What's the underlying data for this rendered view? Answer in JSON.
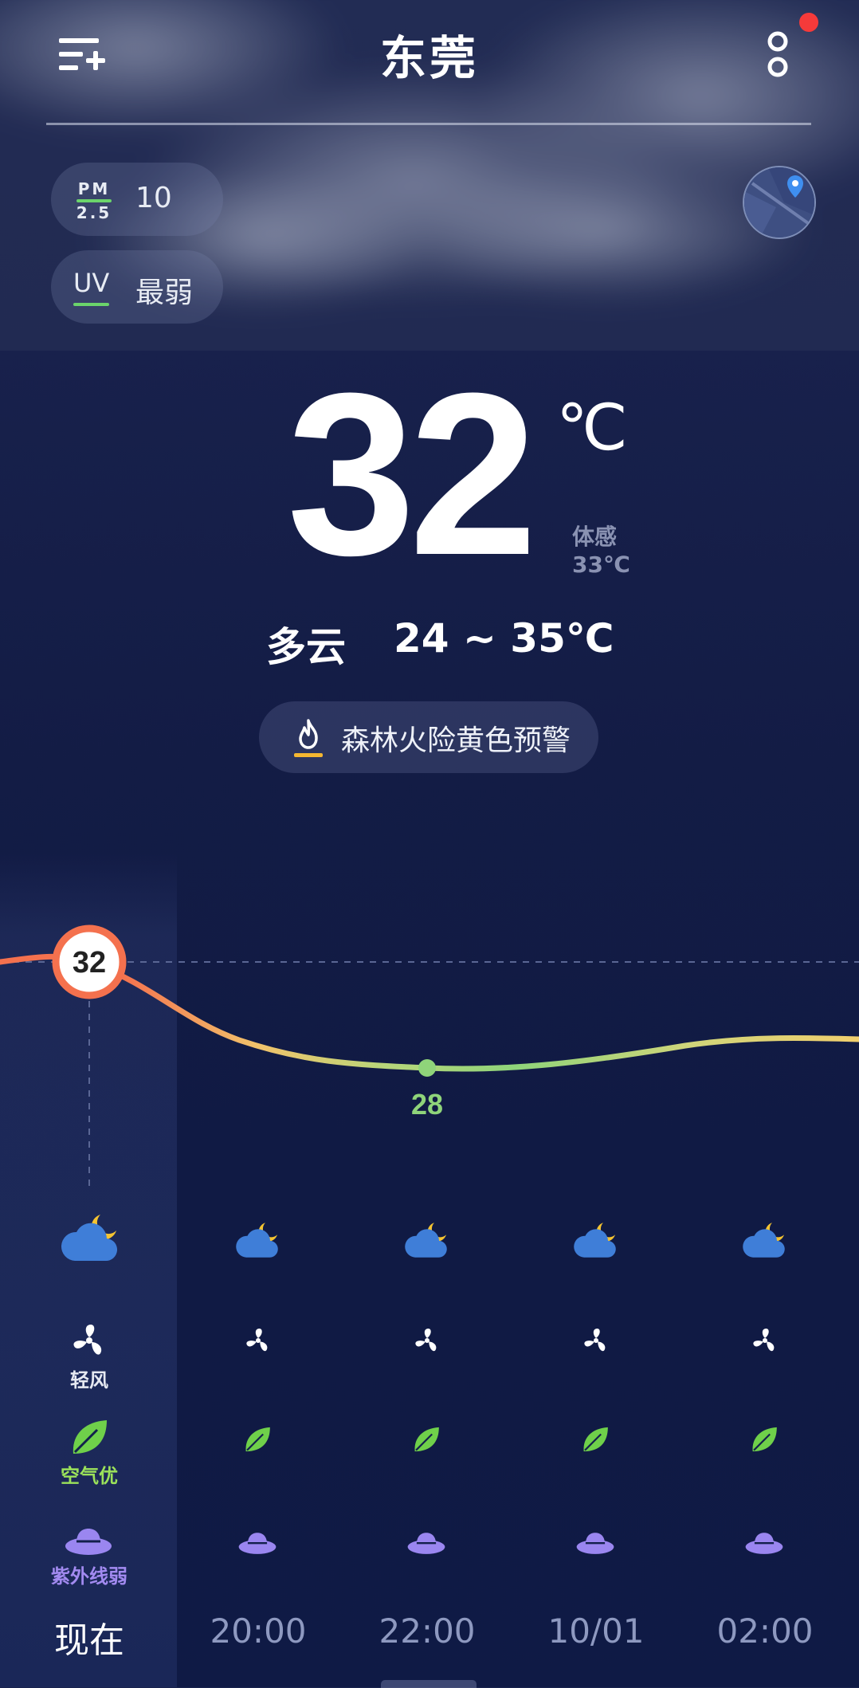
{
  "header": {
    "city": "东莞",
    "menu_icon": "menu-add-icon",
    "more_icon": "more-icon"
  },
  "air": {
    "pm_icon_top": "PM",
    "pm_icon_bottom": "2.5",
    "pm_value": "10",
    "uv_icon_text": "UV",
    "uv_value": "最弱"
  },
  "current": {
    "temperature": "32",
    "unit": "℃",
    "feels_like_label": "体感",
    "feels_like_value": "33℃",
    "condition": "多云",
    "range": "24 ~ 35℃"
  },
  "alert": {
    "text": "森林火险黄色预警",
    "color": "#f5b731"
  },
  "hourly": {
    "chart_data": {
      "type": "line",
      "title": "",
      "points": [
        {
          "label": "现在",
          "value": 32
        },
        {
          "label": "22:00",
          "value": 28
        }
      ],
      "max_label": "32",
      "min_label": "28"
    },
    "times": [
      "现在",
      "20:00",
      "22:00",
      "10/01",
      "02:00"
    ],
    "weather_icon": "cloudy-night-icon",
    "wind_label_now": "轻风",
    "air_label_now": "空气优",
    "uv_label_now": "紫外线弱"
  },
  "colors": {
    "curve_hot": "#f4714e",
    "curve_mid": "#f1c36b",
    "curve_cool": "#8fd47a",
    "leaf": "#6fd04a",
    "hat": "#9a86f0",
    "notification": "#f53a3a"
  }
}
